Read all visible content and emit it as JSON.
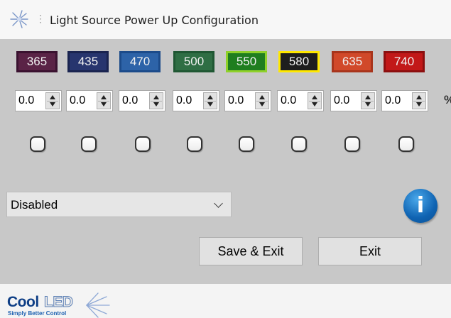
{
  "window": {
    "title": "Light Source Power Up Configuration",
    "icon": "starburst-icon"
  },
  "wavelengths": [
    {
      "label": "365",
      "fill": "#5a2346",
      "border": "#3a1230"
    },
    {
      "label": "435",
      "fill": "#27356e",
      "border": "#1a2450"
    },
    {
      "label": "470",
      "fill": "#2d63a8",
      "border": "#1c4b8a"
    },
    {
      "label": "500",
      "fill": "#2f6e44",
      "border": "#1f5733"
    },
    {
      "label": "550",
      "fill": "#1f7e1f",
      "border": "#8fd12a"
    },
    {
      "label": "580",
      "fill": "#1e1e1e",
      "border": "#ffe800"
    },
    {
      "label": "635",
      "fill": "#d1492a",
      "border": "#a8351c"
    },
    {
      "label": "740",
      "fill": "#c21818",
      "border": "#8c0f0f"
    }
  ],
  "power_levels": [
    "0.0",
    "0.0",
    "0.0",
    "0.0",
    "0.0",
    "0.0",
    "0.0",
    "0.0"
  ],
  "percent_unit": "%",
  "channel_enabled": [
    false,
    false,
    false,
    false,
    false,
    false,
    false,
    false
  ],
  "mode_select": {
    "value": "Disabled",
    "icon": "chevron-down-icon"
  },
  "info": {
    "glyph": "i",
    "icon": "info-icon"
  },
  "buttons": {
    "save_exit": "Save & Exit",
    "exit": "Exit"
  },
  "footer": {
    "logo_primary": "Cool",
    "logo_secondary": "LED",
    "logo_tagline": "Simply Better Control"
  },
  "colors": {
    "window_bg": "#c8c8c8",
    "titlebar_bg": "#f7f7f7",
    "footer_bg": "#f4f4f4",
    "info_blue": "#0f63b2",
    "logo_blue": "#0f3f86"
  }
}
